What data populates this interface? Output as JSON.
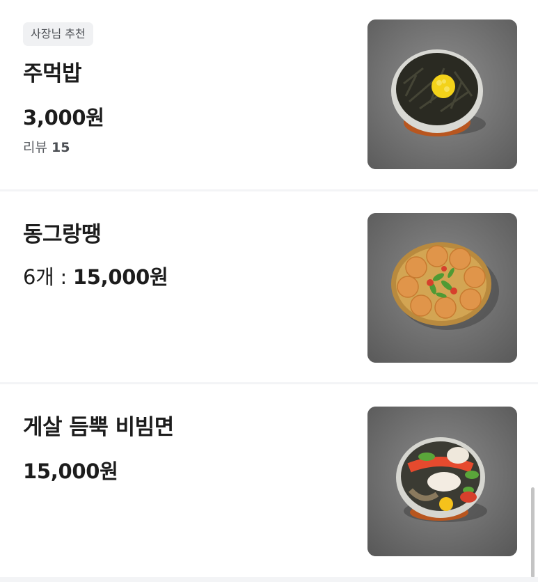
{
  "menu": {
    "items": [
      {
        "badge": "사장님 추천",
        "name": "주먹밥",
        "price": "3,000원",
        "reviews_label": "리뷰",
        "reviews_count": "15",
        "image_icon": "rice-ball-bowl-photo"
      },
      {
        "name": "동그랑땡",
        "qty": "6개 : ",
        "price": "15,000원",
        "image_icon": "pancake-basket-photo"
      },
      {
        "name": "게살 듬뿍 비빔면",
        "price": "15,000원",
        "image_icon": "noodle-bowl-photo"
      }
    ]
  },
  "colors": {
    "background": "#ffffff",
    "divider": "#f3f4f6",
    "badge_bg": "#f0f1f3",
    "text_primary": "#1c1c1c",
    "text_secondary": "#5b5e63"
  }
}
